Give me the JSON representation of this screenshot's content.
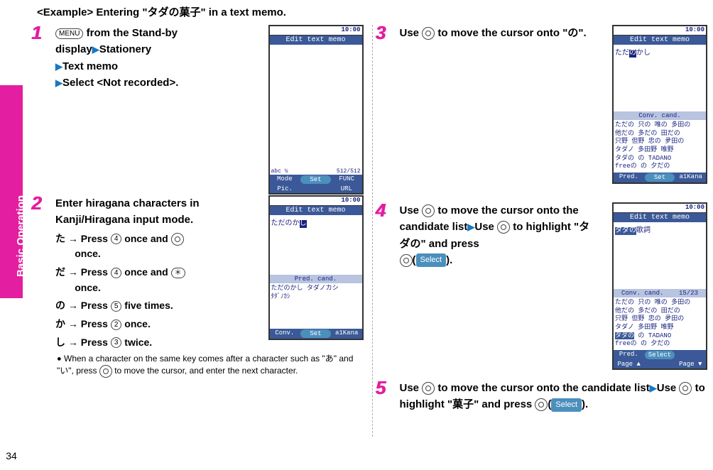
{
  "side_tab": "Basic Operation",
  "page_num": "34",
  "example_title": "<Example> Entering \"タダの菓子\" in a text memo.",
  "phone": {
    "time": "10:00",
    "title": "Edit text memo",
    "bottom_mode": "Mode",
    "bottom_pic": "Pic.",
    "bottom_set": "Set",
    "bottom_func": "FUNC",
    "bottom_url": "URL",
    "conv": "Conv.",
    "a1kana": "a1Kana",
    "pred": "Pred.",
    "page_up": "Page ▲",
    "page_dn": "Page ▼",
    "select": "Select",
    "conv_cand": "Conv. cand.",
    "pred_cand": "Pred. cand.",
    "status1": "abc ½",
    "status1b": "512/512",
    "count_15_23": "15/23"
  },
  "steps": {
    "s1": {
      "num": "1",
      "menu": "MENU",
      "l1a": " from the Stand-by ",
      "l1b": "display",
      "l1c": "Stationery",
      "l2": "Text memo",
      "l3": "Select <Not recorded>."
    },
    "s2": {
      "num": "2",
      "l1": "Enter hiragana characters in Kanji/Hiragana input mode.",
      "sub_ta": "た",
      "sub_ta_act": "Press ",
      "sub_ta_key": "4",
      "sub_ta_act2": " once and ",
      "sub_ta_act3": "once.",
      "sub_da": "だ",
      "sub_da_act": "Press ",
      "sub_da_key": "4",
      "sub_da_act2": " once and ",
      "sub_da_star": "＊",
      "sub_da_act3": "once.",
      "sub_no": "の",
      "sub_no_act": "Press ",
      "sub_no_key": "5",
      "sub_no_act2": " five times.",
      "sub_ka": "か",
      "sub_ka_act": "Press ",
      "sub_ka_key": "2",
      "sub_ka_act2": " once.",
      "sub_shi": "し",
      "sub_shi_act": "Press ",
      "sub_shi_key": "3",
      "sub_shi_act2": " twice.",
      "note": "When a character on the same key comes after a character such as \"あ\" and \"い\", press ",
      "note2": " to move the cursor, and enter the next character."
    },
    "s3": {
      "num": "3",
      "l1": "Use ",
      "l2": " to move the cursor onto \"",
      "l2b": "の",
      "l2c": "\"."
    },
    "s4": {
      "num": "4",
      "l1": "Use ",
      "l2": " to move the cursor onto the candidate list",
      "l3": "Use ",
      "l4": " to highlight \"",
      "l4b": "タダの",
      "l4c": "\" and press ",
      "select": "Select",
      "l5": ")."
    },
    "s5": {
      "num": "5",
      "l1": "Use ",
      "l2": " to move the cursor onto the candidate list",
      "l3": "Use ",
      "l4": " to highlight \"",
      "l4b": "菓子",
      "l4c": "\" and press ",
      "select": "Select",
      "l5": ")."
    }
  },
  "cand": {
    "p2_body": "ただのかし",
    "p2_pred": "ただのかし タダノカシ\nﾀﾀﾞﾉｶｼ",
    "p3_body": "ただのかし",
    "p3_cand": "ただの 只の 唯の 多田の\n他だの 多だの 田だの\n只野 但野 忠の 夛田の\nタダノ 多田野 唯野\nタダの の TADANO\nfreeの の 夕だの",
    "p4_body": "タダの歌詞",
    "p4_cand": "ただの 只の 唯の 多田の\n他だの 多だの 田だの\n只野 但野 忠の 夛田の\nタダノ 多田野 唯野\nタダの の TADANO\nfreeの の 夕だの"
  }
}
